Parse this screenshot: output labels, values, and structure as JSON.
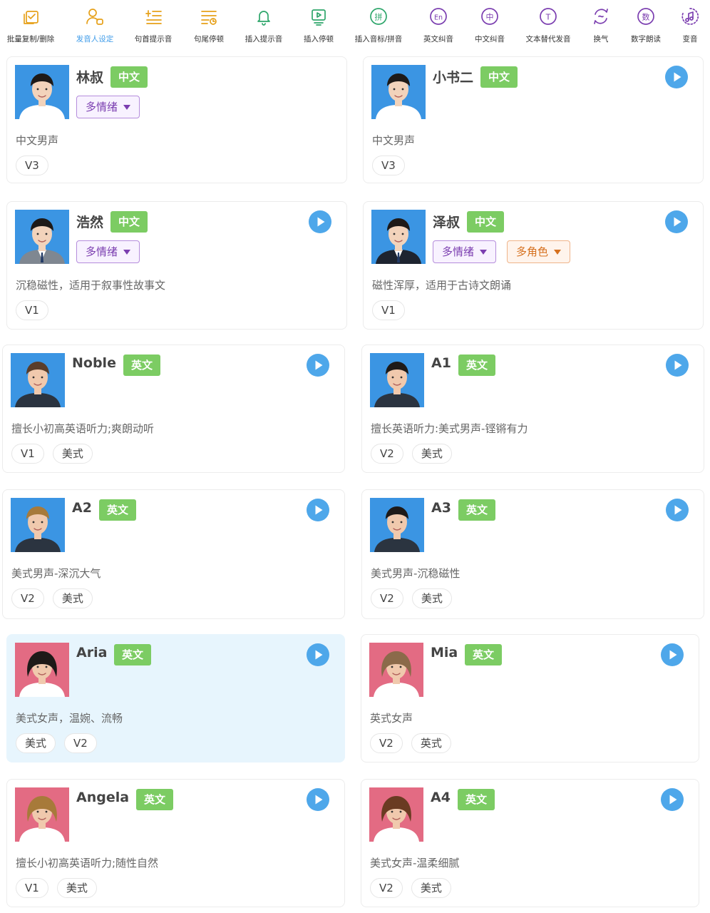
{
  "toolbar": {
    "items": [
      {
        "label": "批量复制/删除",
        "icon": "batch-copy-icon",
        "color": "#e6a019"
      },
      {
        "label": "发音人设定",
        "icon": "speaker-setting-icon",
        "color": "#e6a019",
        "active": true
      },
      {
        "label": "句首提示音",
        "icon": "sentence-start-icon",
        "color": "#e6a019"
      },
      {
        "label": "句尾停顿",
        "icon": "sentence-end-icon",
        "color": "#e6a019"
      },
      {
        "label": "插入提示音",
        "icon": "bell-icon",
        "color": "#2ea66b"
      },
      {
        "label": "插入停顿",
        "icon": "pause-icon",
        "color": "#2ea66b"
      },
      {
        "label": "插入音标/拼音",
        "icon": "pinyin-icon",
        "color": "#2ea66b"
      },
      {
        "label": "英文纠音",
        "icon": "en-icon",
        "color": "#7b3eb0"
      },
      {
        "label": "中文纠音",
        "icon": "zh-icon",
        "color": "#7b3eb0"
      },
      {
        "label": "文本替代发音",
        "icon": "text-replace-icon",
        "color": "#7b3eb0"
      },
      {
        "label": "换气",
        "icon": "breath-icon",
        "color": "#7b3eb0"
      },
      {
        "label": "数字朗读",
        "icon": "number-icon",
        "color": "#7b3eb0"
      },
      {
        "label": "变音",
        "icon": "voice-change-icon",
        "color": "#7b3eb0"
      }
    ],
    "glyphs": {
      "pinyin": "拼",
      "en": "En",
      "zh": "中",
      "text": "T",
      "number": "数"
    }
  },
  "colors": {
    "accent": "#3d9be9",
    "play": "#4ea7ea",
    "lang_tag": "#7ccc63",
    "selected_bg": "#e7f5fd"
  },
  "voices": [
    {
      "name": "林叔",
      "lang": "中文",
      "avatar": "male-asian-white-shirt",
      "dropdowns": [
        {
          "label": "多情绪",
          "style": "purple"
        }
      ],
      "desc": "中文男声",
      "tags": [
        "V3"
      ],
      "play": false
    },
    {
      "name": "小书二",
      "lang": "中文",
      "avatar": "male-asian-white-shirt",
      "dropdowns": [],
      "desc": "中文男声",
      "tags": [
        "V3"
      ],
      "play": true
    },
    {
      "name": "浩然",
      "lang": "中文",
      "avatar": "male-asian-suit-grey",
      "dropdowns": [
        {
          "label": "多情绪",
          "style": "purple"
        }
      ],
      "desc": "沉稳磁性，适用于叙事性故事文",
      "tags": [
        "V1"
      ],
      "play": true
    },
    {
      "name": "泽叔",
      "lang": "中文",
      "avatar": "male-asian-suit-black",
      "dropdowns": [
        {
          "label": "多情绪",
          "style": "purple"
        },
        {
          "label": "多角色",
          "style": "orange"
        }
      ],
      "desc": "磁性浑厚，适用于古诗文朗诵",
      "tags": [
        "V1"
      ],
      "play": true
    },
    {
      "name": "Noble",
      "lang": "英文",
      "avatar": "male-western-beard",
      "dropdowns": [],
      "desc": "擅长小初高英语听力;爽朗动听",
      "tags": [
        "V1",
        "美式"
      ],
      "play": true
    },
    {
      "name": "A1",
      "lang": "英文",
      "avatar": "male-western-smile",
      "dropdowns": [],
      "desc": "擅长英语听力:美式男声-铿锵有力",
      "tags": [
        "V2",
        "美式"
      ],
      "play": true
    },
    {
      "name": "A2",
      "lang": "英文",
      "avatar": "male-western-blond",
      "dropdowns": [],
      "desc": "美式男声-深沉大气",
      "tags": [
        "V2",
        "美式"
      ],
      "play": true
    },
    {
      "name": "A3",
      "lang": "英文",
      "avatar": "male-western-dark",
      "dropdowns": [],
      "desc": "美式男声-沉稳磁性",
      "tags": [
        "V2",
        "美式"
      ],
      "play": true
    },
    {
      "name": "Aria",
      "lang": "英文",
      "avatar": "female-western-dark-hair",
      "dropdowns": [],
      "desc": "美式女声，温婉、流畅",
      "tags": [
        "美式",
        "V2"
      ],
      "play": true,
      "selected": true
    },
    {
      "name": "Mia",
      "lang": "英文",
      "avatar": "female-western-long-hair",
      "dropdowns": [],
      "desc": "英式女声",
      "tags": [
        "V2",
        "英式"
      ],
      "play": true
    },
    {
      "name": "Angela",
      "lang": "英文",
      "avatar": "female-western-blonde",
      "dropdowns": [],
      "desc": "擅长小初高英语听力;随性自然",
      "tags": [
        "V1",
        "美式"
      ],
      "play": true
    },
    {
      "name": "A4",
      "lang": "英文",
      "avatar": "female-western-brown",
      "dropdowns": [],
      "desc": "美式女声-温柔细腻",
      "tags": [
        "V2",
        "美式"
      ],
      "play": true
    }
  ]
}
